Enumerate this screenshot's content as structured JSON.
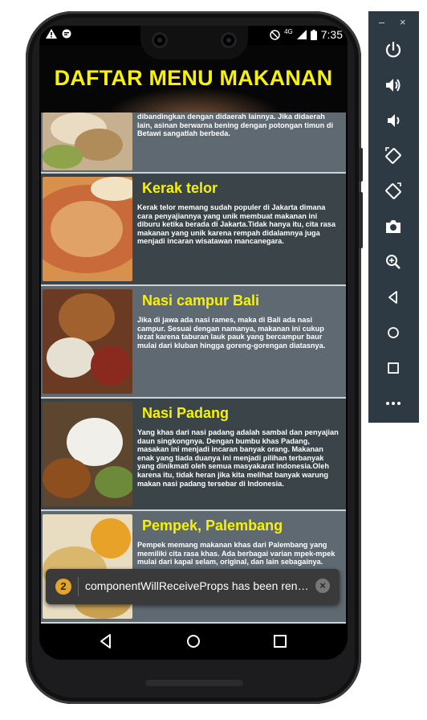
{
  "status_bar": {
    "time": "7:35",
    "network": "4G",
    "icons": [
      "warning-icon",
      "notification-icon",
      "dnd-icon",
      "signal-icon",
      "battery-icon"
    ]
  },
  "app": {
    "title": "DAFTAR MENU MAKANAN",
    "title_color": "#f7f10a"
  },
  "menu": [
    {
      "name": "",
      "description": "dibandingkan dengan didaerah lainnya. Jika didaerah lain, asinan berwarna bening dengan potongan timun di Betawi sangatlah berbeda."
    },
    {
      "name": "Kerak telor",
      "description": "Kerak telor memang sudah populer di Jakarta dimana cara penyajiannya yang unik membuat makanan ini diburu ketika berada di Jakarta.Tidak hanya itu, cita rasa makanan yang unik karena rempah didalamnya juga menjadi incaran wisatawan mancanegara."
    },
    {
      "name": "Nasi campur Bali",
      "description": "Jika di jawa ada nasi rames, maka di Bali ada nasi campur. Sesuai dengan namanya, makanan ini cukup lezat karena taburan lauk pauk yang bercampur baur mulai dari kluban hingga goreng-gorengan diatasnya."
    },
    {
      "name": "Nasi Padang",
      "description": "Yang khas dari nasi padang adalah sambal dan penyajian daun singkongnya. Dengan bumbu khas Padang, masakan ini menjadi incaran banyak orang. Makanan enak yang tiada duanya ini menjadi pilihan terbanyak yang dinikmati oleh semua masyakarat indonesia.Oleh karena itu, tidak heran jika kita melihat banyak warung makan nasi padang tersebar di Indonesia."
    },
    {
      "name": "Pempek, Palembang",
      "description": "Pempek memang makanan khas dari Palembang yang memiliki cita rasa khas. Ada berbagai varian mpek-mpek mulai dari kapal selam, original, dan lain sebagainya."
    }
  ],
  "toast": {
    "count": "2",
    "message": "componentWillReceiveProps has been renamed, and is not recommended for use."
  },
  "navbar": {
    "icons": [
      "back-icon",
      "home-icon",
      "recents-icon"
    ]
  },
  "emulator_toolbar": {
    "minimize": "–",
    "close": "×",
    "buttons": [
      "power-icon",
      "volume-up-icon",
      "volume-down-icon",
      "rotate-left-icon",
      "rotate-right-icon",
      "camera-icon",
      "zoom-icon",
      "back-icon",
      "home-icon",
      "overview-icon",
      "more-icon"
    ]
  }
}
